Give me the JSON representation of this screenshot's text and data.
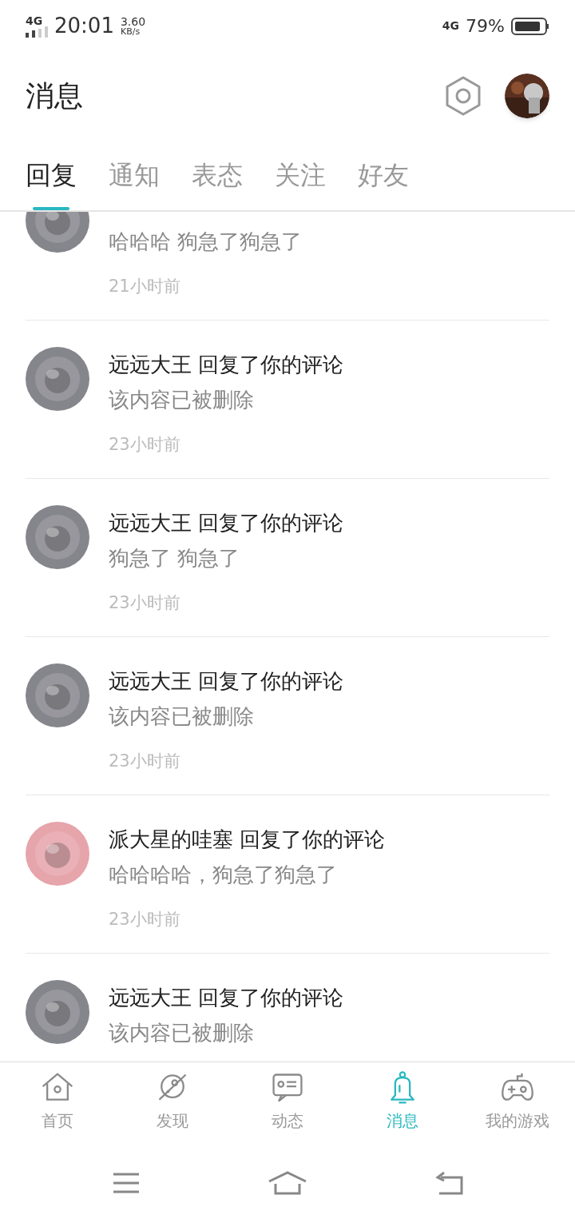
{
  "status_bar": {
    "network": "4G",
    "time": "20:01",
    "speed_value": "3.60",
    "speed_unit": "KB/s",
    "network_right": "4G",
    "battery": "79%"
  },
  "header": {
    "title": "消息"
  },
  "tabs": [
    {
      "label": "回复",
      "selected": true
    },
    {
      "label": "通知",
      "selected": false
    },
    {
      "label": "表态",
      "selected": false
    },
    {
      "label": "关注",
      "selected": false
    },
    {
      "label": "好友",
      "selected": false
    }
  ],
  "messages": [
    {
      "color": "#85858c",
      "body": "哈哈哈 狗急了狗急了",
      "time": "21小时前"
    },
    {
      "color": "#85858c",
      "title": "远远大王 回复了你的评论",
      "body": "该内容已被删除",
      "time": "23小时前"
    },
    {
      "color": "#85858c",
      "title": "远远大王 回复了你的评论",
      "body": "狗急了 狗急了",
      "time": "23小时前"
    },
    {
      "color": "#85858c",
      "title": "远远大王 回复了你的评论",
      "body": "该内容已被删除",
      "time": "23小时前"
    },
    {
      "color": "#e6a4ab",
      "title": "派大星的哇塞 回复了你的评论",
      "body": "哈哈哈哈，狗急了狗急了",
      "time": "23小时前"
    },
    {
      "color": "#85858c",
      "title": "远远大王 回复了你的评论",
      "body": "该内容已被删除"
    }
  ],
  "bottom_nav": [
    {
      "label": "首页",
      "kind": "home",
      "selected": false
    },
    {
      "label": "发现",
      "kind": "planet",
      "selected": false
    },
    {
      "label": "动态",
      "kind": "feed",
      "selected": false
    },
    {
      "label": "消息",
      "kind": "bell",
      "selected": true
    },
    {
      "label": "我的游戏",
      "kind": "gamepad",
      "selected": false
    }
  ]
}
